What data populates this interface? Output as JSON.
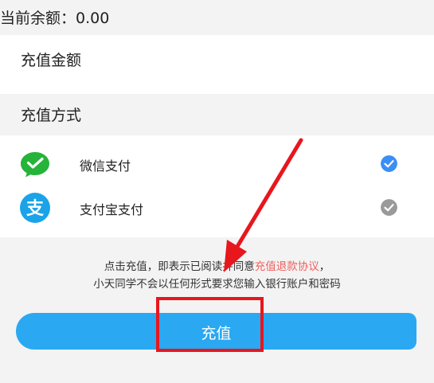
{
  "balance": {
    "text": "当前余额：0.00"
  },
  "amount_section": {
    "label": "充值金额"
  },
  "method_section": {
    "label": "充值方式"
  },
  "payment_methods": [
    {
      "label": "微信支付",
      "icon": "wechat-pay-icon",
      "selected": true
    },
    {
      "label": "支付宝支付",
      "icon": "alipay-icon",
      "selected": false
    }
  ],
  "agreement": {
    "prefix": "点击充值，即表示已阅读并同意",
    "link": "充值退款协议",
    "suffix": "，",
    "line2": "小天同学不会以任何形式要求您输入银行账户和密码"
  },
  "submit_button": {
    "label": "充值"
  },
  "colors": {
    "accent": "#2aa8f2",
    "link": "#f06060",
    "annotation": "#e8161d",
    "check_selected": "#3b8ef5",
    "check_unselected": "#9a9a9a"
  }
}
